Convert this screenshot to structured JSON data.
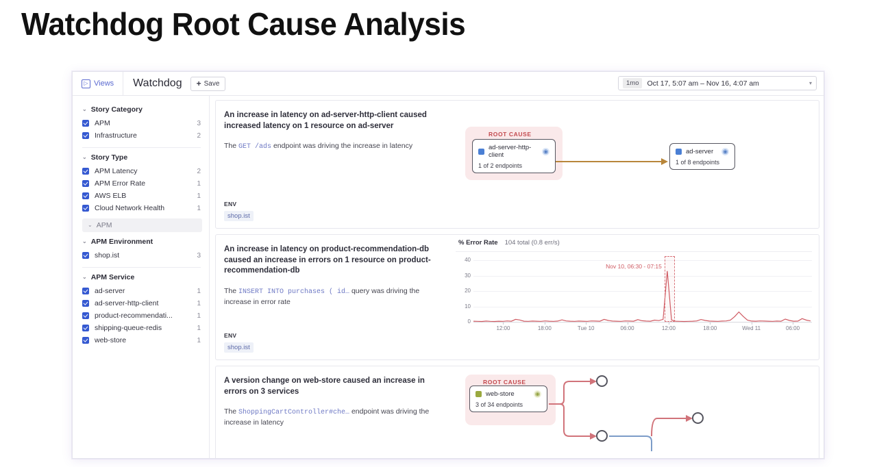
{
  "slide": {
    "title": "Watchdog Root Cause Analysis"
  },
  "topbar": {
    "views_label": "Views",
    "views_icon": "views-panel-icon",
    "app_title": "Watchdog",
    "save_label": "Save",
    "save_plus": "+",
    "timerange": {
      "badge": "1mo",
      "text": "Oct 17, 5:07 am – Nov 16, 4:07 am",
      "caret": "▾"
    }
  },
  "sidebar": {
    "chevron": "⌄",
    "collapsed_group": {
      "label": "APM"
    },
    "facets": [
      {
        "title": "Story Category",
        "rows": [
          {
            "label": "APM",
            "count": "3",
            "checked": true
          },
          {
            "label": "Infrastructure",
            "count": "2",
            "checked": true
          }
        ]
      },
      {
        "title": "Story Type",
        "rows": [
          {
            "label": "APM Latency",
            "count": "2",
            "checked": true
          },
          {
            "label": "APM Error Rate",
            "count": "1",
            "checked": true
          },
          {
            "label": "AWS ELB",
            "count": "1",
            "checked": true
          },
          {
            "label": "Cloud Network Health",
            "count": "1",
            "checked": true
          }
        ]
      },
      {
        "title": "APM Environment",
        "rows": [
          {
            "label": "shop.ist",
            "count": "3",
            "checked": true
          }
        ]
      },
      {
        "title": "APM Service",
        "rows": [
          {
            "label": "ad-server",
            "count": "1",
            "checked": true
          },
          {
            "label": "ad-server-http-client",
            "count": "1",
            "checked": true
          },
          {
            "label": "product-recommendati...",
            "count": "1",
            "checked": true
          },
          {
            "label": "shipping-queue-redis",
            "count": "1",
            "checked": true
          },
          {
            "label": "web-store",
            "count": "1",
            "checked": true
          }
        ]
      }
    ]
  },
  "stories": [
    {
      "title": "An increase in latency on ad-server-http-client caused increased latency on 1 resource on ad-server",
      "desc_pre": "The ",
      "desc_code": "GET  /ads",
      "desc_post": " endpoint was driving the increase in latency",
      "env_label": "ENV",
      "env_value": "shop.ist",
      "graph": {
        "root_cause_label": "ROOT CAUSE",
        "nodes": [
          {
            "name": "ad-server-http-client",
            "sub": "1 of 2 endpoints",
            "color": "blue"
          },
          {
            "name": "ad-server",
            "sub": "1 of 8 endpoints",
            "color": "blue"
          }
        ],
        "edge_color": "#b8863a"
      }
    },
    {
      "title": "An increase in latency on product-recommendation-db caused an increase in errors on 1 resource on product-recommendation-db",
      "desc_pre": "The ",
      "desc_code": "INSERT INTO purchases ( id…",
      "desc_post": "  query was driving the increase in error rate",
      "env_label": "ENV",
      "env_value": "shop.ist"
    },
    {
      "title": "A version change on web-store caused an increase in errors on 3 services",
      "desc_pre": "The ",
      "desc_code": "ShoppingCartController#che…",
      "desc_post": "  endpoint was driving the increase in latency",
      "graph": {
        "root_cause_label": "ROOT CAUSE",
        "nodes": [
          {
            "name": "web-store",
            "sub": "3 of 34 endpoints",
            "color": "olive"
          }
        ],
        "edge_color_primary": "#d1737a",
        "edge_color_secondary": "#7c9cc8"
      }
    }
  ],
  "chart_data": {
    "type": "line",
    "title": "% Error Rate",
    "subtitle": "104 total (0.8 err/s)",
    "xlabel": "",
    "ylabel": "",
    "ylim": [
      0,
      40
    ],
    "yticks": [
      0,
      10,
      20,
      30,
      40
    ],
    "grid": true,
    "legend": "none",
    "annotation": "Nov 10, 06:30 - 07:15",
    "selection": {
      "start": "Nov 10, 06:30",
      "end": "Nov 10, 07:15"
    },
    "xticks": [
      "12:00",
      "18:00",
      "Tue 10",
      "06:00",
      "12:00",
      "18:00",
      "Wed 11",
      "06:00"
    ],
    "series": [
      {
        "name": "% Error Rate",
        "color": "#cf5a62",
        "x": [
          0,
          1,
          2,
          3,
          4,
          5,
          6,
          7,
          8,
          9,
          10,
          11,
          12,
          13,
          14,
          15,
          16,
          17,
          18,
          19,
          20,
          21,
          22,
          23,
          24,
          25,
          26,
          27,
          28,
          29,
          30,
          31,
          32,
          33,
          34,
          35,
          36,
          37,
          38,
          39,
          40,
          41,
          42,
          43,
          44,
          45,
          46,
          47,
          48,
          49,
          50,
          51,
          52,
          53,
          54,
          55,
          56,
          57,
          58,
          59,
          60,
          61,
          62,
          63,
          64,
          65,
          66,
          67,
          68,
          69,
          70,
          71,
          72,
          73,
          74,
          75,
          76,
          77,
          78,
          79,
          80
        ],
        "values": [
          0.4,
          0.3,
          0.2,
          0.5,
          0.3,
          0.2,
          0.4,
          0.3,
          0.6,
          0.4,
          1.6,
          1.2,
          0.4,
          0.3,
          0.5,
          0.4,
          0.3,
          0.6,
          0.4,
          0.3,
          0.5,
          1.3,
          0.6,
          0.4,
          0.3,
          0.5,
          0.4,
          0.3,
          0.6,
          0.5,
          0.4,
          1.6,
          0.9,
          0.5,
          0.4,
          0.3,
          0.6,
          0.5,
          0.4,
          1.4,
          0.7,
          0.5,
          0.4,
          1.1,
          0.8,
          1.6,
          33,
          1.2,
          0.4,
          0.3,
          0.2,
          0.3,
          0.4,
          0.6,
          1.5,
          0.9,
          0.5,
          0.4,
          0.3,
          0.5,
          0.6,
          1.1,
          3.4,
          6.4,
          3.6,
          1.1,
          0.5,
          0.4,
          0.6,
          0.5,
          0.4,
          0.3,
          0.5,
          0.4,
          1.8,
          0.9,
          0.4,
          0.5,
          2.1,
          1.1,
          0.6
        ]
      }
    ]
  }
}
